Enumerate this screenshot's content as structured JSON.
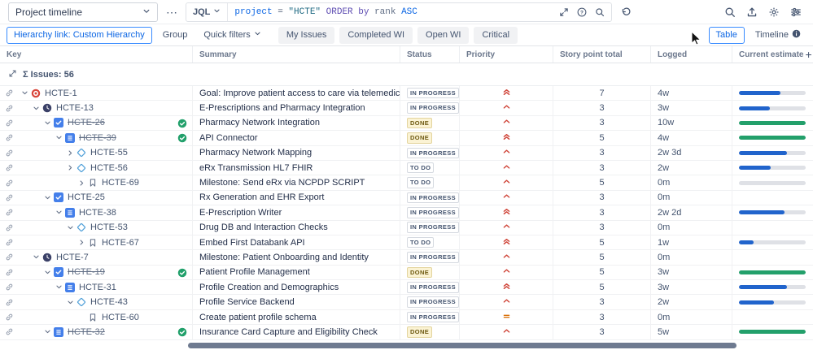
{
  "topbar": {
    "view_selector": "Project timeline",
    "jql_label": "JQL",
    "query_tokens": [
      {
        "text": "project ",
        "color": "#0c66e4"
      },
      {
        "text": "= ",
        "color": "#44546f"
      },
      {
        "text": "\"HCTE\" ",
        "color": "#206a83"
      },
      {
        "text": "ORDER by ",
        "color": "#5e4db2"
      },
      {
        "text": "rank ",
        "color": "#626f86"
      },
      {
        "text": "ASC",
        "color": "#0c66e4"
      }
    ]
  },
  "toolbar": {
    "hierarchy_button": "Hierarchy link: Custom Hierarchy",
    "group_button": "Group",
    "quick_filters_button": "Quick filters",
    "filter_buttons": [
      "My Issues",
      "Completed WI",
      "Open WI",
      "Critical"
    ],
    "table_button": "Table",
    "timeline_button": "Timeline"
  },
  "icons": {
    "more": "⋯",
    "add_column": "+"
  },
  "table": {
    "columns": [
      "Key",
      "Summary",
      "Status",
      "Priority",
      "Story point total",
      "Logged",
      "Current estimate"
    ],
    "issues_total": "Σ Issues: 56",
    "rows": [
      {
        "key": "HCTE-1",
        "level": 0,
        "chevron": "down",
        "type": "goal",
        "done": false,
        "summary": "Goal: Improve patient access to care via telemedicine",
        "status": "IN PROGRESS",
        "status_kind": "inprogress",
        "priority": "highest",
        "points": "7",
        "logged": "4w",
        "bar": {
          "color": "blue",
          "fill": 62
        }
      },
      {
        "key": "HCTE-13",
        "level": 1,
        "chevron": "down",
        "type": "clock",
        "done": false,
        "summary": "E-Prescriptions and Pharmacy Integration",
        "status": "IN PROGRESS",
        "status_kind": "inprogress",
        "priority": "high",
        "points": "3",
        "logged": "3w",
        "bar": {
          "color": "blue",
          "fill": 46
        }
      },
      {
        "key": "HCTE-26",
        "level": 2,
        "chevron": "down",
        "type": "task",
        "done": true,
        "summary": "Pharmacy Network Integration",
        "status": "DONE",
        "status_kind": "done",
        "priority": "high",
        "points": "3",
        "logged": "10w",
        "bar": {
          "color": "green",
          "fill": 100
        }
      },
      {
        "key": "HCTE-39",
        "level": 3,
        "chevron": "down",
        "type": "list",
        "done": true,
        "summary": "API Connector",
        "status": "DONE",
        "status_kind": "done",
        "priority": "highest",
        "points": "5",
        "logged": "4w",
        "bar": {
          "color": "green",
          "fill": 100
        }
      },
      {
        "key": "HCTE-55",
        "level": 4,
        "chevron": "right",
        "type": "diamond",
        "done": false,
        "summary": "Pharmacy Network Mapping",
        "status": "IN PROGRESS",
        "status_kind": "inprogress",
        "priority": "high",
        "points": "3",
        "logged": "2w 3d",
        "bar": {
          "color": "blue",
          "fill": 72
        }
      },
      {
        "key": "HCTE-56",
        "level": 4,
        "chevron": "right",
        "type": "diamond",
        "done": false,
        "summary": "eRx Transmission HL7 FHIR",
        "status": "TO DO",
        "status_kind": "todo",
        "priority": "high",
        "points": "3",
        "logged": "2w",
        "bar": {
          "color": "blue",
          "fill": 48
        }
      },
      {
        "key": "HCTE-69",
        "level": 5,
        "chevron": "right",
        "type": "bookmark",
        "done": false,
        "summary": "Milestone: Send eRx via NCPDP SCRIPT",
        "status": "TO DO",
        "status_kind": "todo",
        "priority": "high",
        "points": "5",
        "logged": "0m",
        "bar": {
          "color": "blue",
          "fill": 0
        }
      },
      {
        "key": "HCTE-25",
        "level": 2,
        "chevron": "down",
        "type": "task",
        "done": false,
        "summary": "Rx Generation and EHR Export",
        "status": "IN PROGRESS",
        "status_kind": "inprogress",
        "priority": "high",
        "points": "3",
        "logged": "0m",
        "bar": null
      },
      {
        "key": "HCTE-38",
        "level": 3,
        "chevron": "down",
        "type": "list",
        "done": false,
        "summary": "E-Prescription Writer",
        "status": "IN PROGRESS",
        "status_kind": "inprogress",
        "priority": "highest",
        "points": "3",
        "logged": "2w 2d",
        "bar": {
          "color": "blue",
          "fill": 68
        }
      },
      {
        "key": "HCTE-53",
        "level": 4,
        "chevron": "down",
        "type": "diamond",
        "done": false,
        "summary": "Drug DB and Interaction Checks",
        "status": "IN PROGRESS",
        "status_kind": "inprogress",
        "priority": "high",
        "points": "3",
        "logged": "0m",
        "bar": null
      },
      {
        "key": "HCTE-67",
        "level": 5,
        "chevron": "right",
        "type": "bookmark",
        "done": false,
        "summary": "Embed First Databank API",
        "status": "TO DO",
        "status_kind": "todo",
        "priority": "highest",
        "points": "5",
        "logged": "1w",
        "bar": {
          "color": "blue",
          "fill": 22
        }
      },
      {
        "key": "HCTE-7",
        "level": 1,
        "chevron": "down",
        "type": "clock",
        "done": false,
        "summary": "Milestone: Patient Onboarding and Identity",
        "status": "IN PROGRESS",
        "status_kind": "inprogress",
        "priority": "high",
        "points": "5",
        "logged": "0m",
        "bar": null
      },
      {
        "key": "HCTE-19",
        "level": 2,
        "chevron": "down",
        "type": "task",
        "done": true,
        "summary": "Patient Profile Management",
        "status": "DONE",
        "status_kind": "done",
        "priority": "high",
        "points": "5",
        "logged": "3w",
        "bar": {
          "color": "green",
          "fill": 100
        }
      },
      {
        "key": "HCTE-31",
        "level": 3,
        "chevron": "down",
        "type": "list",
        "done": false,
        "summary": "Profile Creation and Demographics",
        "status": "IN PROGRESS",
        "status_kind": "inprogress",
        "priority": "highest",
        "points": "5",
        "logged": "3w",
        "bar": {
          "color": "blue",
          "fill": 72
        }
      },
      {
        "key": "HCTE-43",
        "level": 4,
        "chevron": "down",
        "type": "diamond",
        "done": false,
        "summary": "Profile Service Backend",
        "status": "IN PROGRESS",
        "status_kind": "inprogress",
        "priority": "high",
        "points": "3",
        "logged": "2w",
        "bar": {
          "color": "blue",
          "fill": 52
        }
      },
      {
        "key": "HCTE-60",
        "level": 5,
        "chevron": null,
        "type": "bookmark",
        "done": false,
        "summary": "Create patient profile schema",
        "status": "IN PROGRESS",
        "status_kind": "inprogress",
        "priority": "medium",
        "points": "3",
        "logged": "0m",
        "bar": null
      },
      {
        "key": "HCTE-32",
        "level": 2,
        "chevron": "down",
        "type": "list",
        "done": true,
        "summary": "Insurance Card Capture and Eligibility Check",
        "status": "DONE",
        "status_kind": "done",
        "priority": "high",
        "points": "3",
        "logged": "5w",
        "bar": {
          "color": "green",
          "fill": 100
        }
      }
    ]
  },
  "colors": {
    "accent": "#0c66e4",
    "bar_blue": "#2164cc",
    "bar_green": "#23a06b",
    "bar_track": "#dfe1e6",
    "priority_red": "#cf4337",
    "priority_orange": "#d97008",
    "status": {
      "inprogress": {
        "bg": "#ffffff",
        "border": "#d5d9e0",
        "text": "#44546f"
      },
      "todo": {
        "bg": "#ffffff",
        "border": "#d5d9e0",
        "text": "#44546f"
      },
      "done": {
        "bg": "#fbf3d4",
        "border": "#e3d49e",
        "text": "#6e5a12"
      }
    }
  }
}
